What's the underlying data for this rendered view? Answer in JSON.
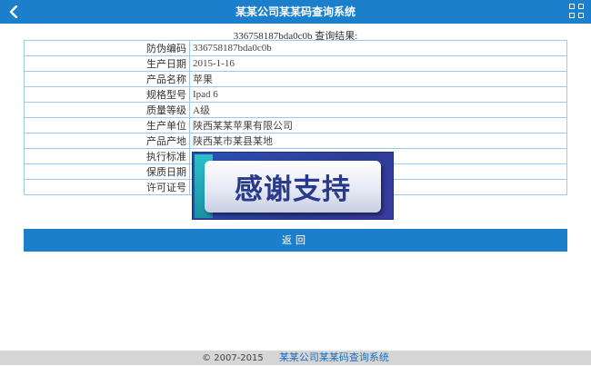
{
  "header": {
    "title": "某某公司某某码查询系统",
    "back_icon": "chevron-left-icon",
    "menu_icon": "grid-icon"
  },
  "result": {
    "code": "336758187bda0c0b",
    "label": "查询结果:"
  },
  "table": {
    "rows": [
      {
        "key": "防伪编码",
        "value": "336758187bda0c0b"
      },
      {
        "key": "生产日期",
        "value": "2015-1-16"
      },
      {
        "key": "产品名称",
        "value": "苹果"
      },
      {
        "key": "规格型号",
        "value": "Ipad 6"
      },
      {
        "key": "质量等级",
        "value": "A级"
      },
      {
        "key": "生产单位",
        "value": "陕西某某苹果有限公司"
      },
      {
        "key": "产品产地",
        "value": "陕西某市某县某地"
      },
      {
        "key": "执行标准",
        "value": ""
      },
      {
        "key": "保质日期",
        "value": ""
      },
      {
        "key": "许可证号",
        "value": ""
      }
    ]
  },
  "overlay": {
    "text": "感谢支持"
  },
  "actions": {
    "back_label": "返回"
  },
  "footer": {
    "copyright": "© 2007-2015",
    "org": "某某公司某某码查询系统"
  },
  "colors": {
    "primary": "#1b7fcc",
    "table_border": "#9ec7e8",
    "footer_bg": "#d6d6d6"
  }
}
